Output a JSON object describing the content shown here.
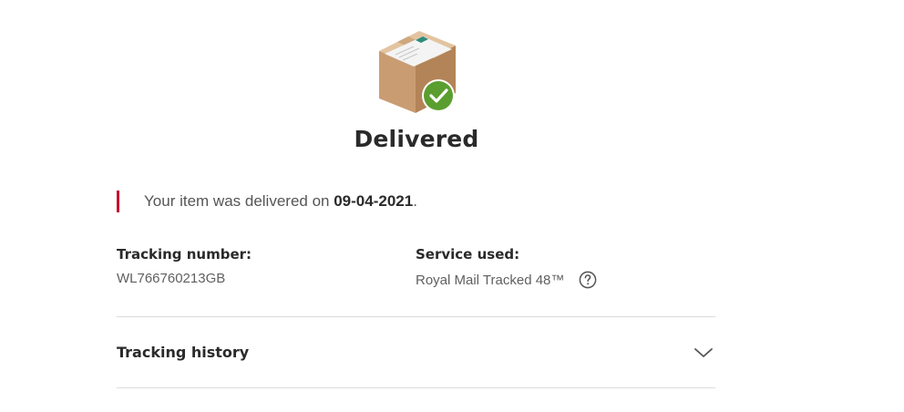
{
  "status": {
    "title": "Delivered",
    "icon": "parcel-delivered-icon",
    "accent_color": "#c8102e",
    "success_color": "#5a9e2f"
  },
  "message": {
    "prefix": "Your item was delivered on ",
    "date": "09-04-2021",
    "suffix": "."
  },
  "tracking": {
    "label": "Tracking number:",
    "value": "WL766760213GB"
  },
  "service": {
    "label": "Service used:",
    "value": "Royal Mail Tracked 48™",
    "help_icon": "question-mark-icon"
  },
  "history": {
    "label": "Tracking history",
    "expanded": false,
    "toggle_icon": "chevron-down-icon"
  }
}
